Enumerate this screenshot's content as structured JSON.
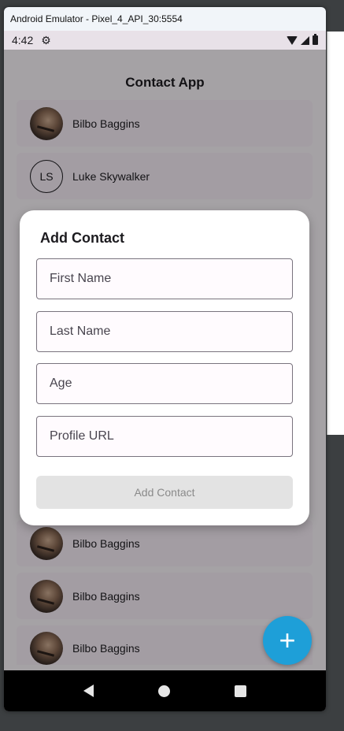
{
  "window": {
    "title": "Android Emulator - Pixel_4_API_30:5554"
  },
  "status_bar": {
    "time": "4:42"
  },
  "app": {
    "title": "Contact App"
  },
  "contacts": [
    {
      "name": "Bilbo Baggins",
      "avatar": "photo"
    },
    {
      "name": "Luke Skywalker",
      "avatar": "initials",
      "initials": "LS"
    },
    {
      "name": "Bilbo Baggins",
      "avatar": "photo"
    },
    {
      "name": "Bilbo Baggins",
      "avatar": "photo"
    },
    {
      "name": "Bilbo Baggins",
      "avatar": "photo"
    }
  ],
  "dialog": {
    "title": "Add Contact",
    "fields": {
      "first_name_placeholder": "First Name",
      "last_name_placeholder": "Last Name",
      "age_placeholder": "Age",
      "profile_url_placeholder": "Profile URL"
    },
    "submit_label": "Add Contact"
  },
  "fab": {
    "icon": "plus-icon",
    "label": "+"
  },
  "colors": {
    "fab": "#1e9fd8",
    "screen_bg": "#f4eff4",
    "dialog_bg": "#ffffff",
    "disabled_button_bg": "#e3e3e3"
  }
}
